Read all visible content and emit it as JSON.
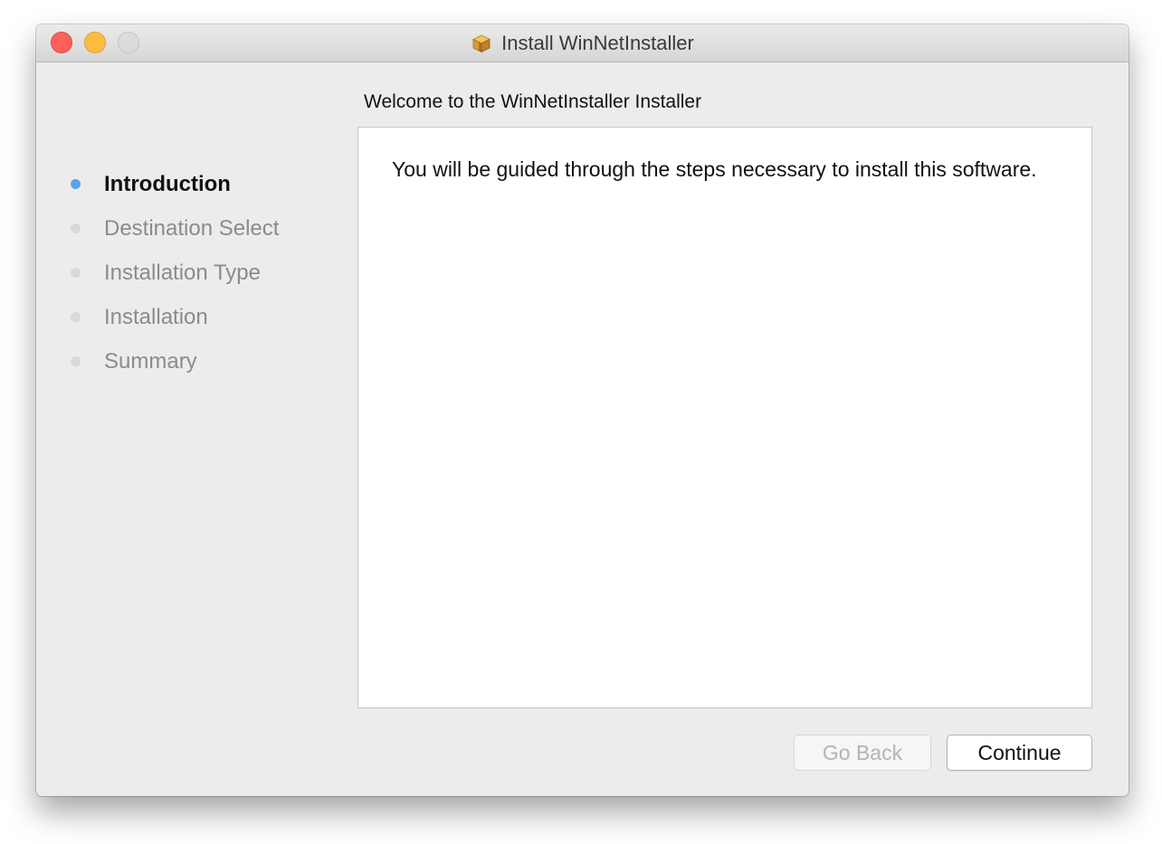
{
  "window": {
    "title": "Install WinNetInstaller",
    "title_icon": "package-icon"
  },
  "page": {
    "heading": "Welcome to the WinNetInstaller Installer",
    "body_text": "You will be guided through the steps necessary to install this software."
  },
  "sidebar": {
    "active_index": 0,
    "steps": [
      {
        "label": "Introduction"
      },
      {
        "label": "Destination Select"
      },
      {
        "label": "Installation Type"
      },
      {
        "label": "Installation"
      },
      {
        "label": "Summary"
      }
    ]
  },
  "buttons": {
    "back_label": "Go Back",
    "back_enabled": false,
    "continue_label": "Continue"
  },
  "colors": {
    "close": "#fc605b",
    "minimize": "#fdbc40",
    "zoom": "#dcdcdc",
    "active_step_dot": "#5aa3ef",
    "inactive_step_dot": "#d9d9d9"
  }
}
